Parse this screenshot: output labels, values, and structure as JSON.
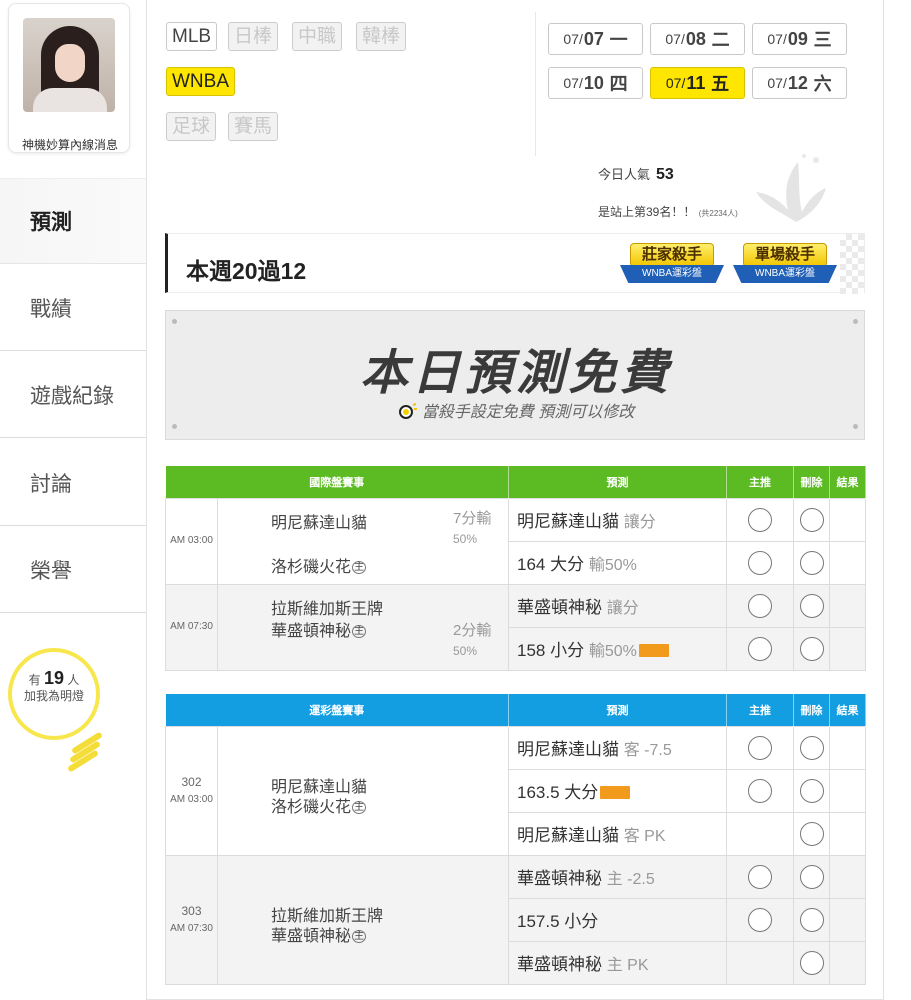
{
  "profile": {
    "name": "神機妙算內線消息"
  },
  "nav": [
    {
      "label": "預測",
      "active": true
    },
    {
      "label": "戰績"
    },
    {
      "label": "遊戲紀錄"
    },
    {
      "label": "討論"
    },
    {
      "label": "榮譽"
    }
  ],
  "lamp": {
    "prefix": "有",
    "count": "19",
    "suffix": "人",
    "line2": "加我為明燈"
  },
  "leagues": [
    "MLB",
    "日棒",
    "中職",
    "韓棒",
    "WNBA",
    "足球",
    "賽馬"
  ],
  "dates": [
    {
      "md": "07/",
      "day": "07",
      "dow": "一"
    },
    {
      "md": "07/",
      "day": "08",
      "dow": "二"
    },
    {
      "md": "07/",
      "day": "09",
      "dow": "三"
    },
    {
      "md": "07/",
      "day": "10",
      "dow": "四"
    },
    {
      "md": "07/",
      "day": "11",
      "dow": "五",
      "selected": true
    },
    {
      "md": "07/",
      "day": "12",
      "dow": "六"
    }
  ],
  "popularity": {
    "label": "今日人氣",
    "value": "53",
    "rank": "是站上第39名！！",
    "total": "(共2234人)"
  },
  "week": {
    "title": "本週20過12"
  },
  "badges": [
    {
      "title": "莊家殺手",
      "ribbon": "WNBA運彩盤"
    },
    {
      "title": "單場殺手",
      "ribbon": "WNBA運彩盤"
    }
  ],
  "banner": {
    "title": "本日預測免費",
    "subtitle": "當殺手設定免費 預測可以修改"
  },
  "intl_table": {
    "headers": [
      "國際盤賽事",
      "預測",
      "主推",
      "刪除",
      "結果"
    ],
    "games": [
      {
        "time": "AM 03:00",
        "away": "明尼蘇達山貓",
        "home": "洛杉磯火花",
        "home_tag": "主",
        "handicap": "7分輸",
        "handicap_pct": "50%",
        "picks": [
          {
            "main": "明尼蘇達山貓",
            "soft": "讓分"
          },
          {
            "main": "164 大分",
            "soft": "輸50%"
          }
        ]
      },
      {
        "time": "AM 07:30",
        "away": "拉斯維加斯王牌",
        "home": "華盛頓神秘",
        "home_tag": "主",
        "handicap": "2分輸",
        "handicap_pct": "50%",
        "picks": [
          {
            "main": "華盛頓神秘",
            "soft": "讓分"
          },
          {
            "main": "158 小分",
            "soft": "輸50%",
            "featured": true
          }
        ]
      }
    ]
  },
  "lottery_table": {
    "headers": [
      "運彩盤賽事",
      "預測",
      "主推",
      "刪除",
      "結果"
    ],
    "games": [
      {
        "number": "302",
        "time": "AM 03:00",
        "away": "明尼蘇達山貓",
        "home": "洛杉磯火花",
        "home_tag": "主",
        "picks": [
          {
            "main": "明尼蘇達山貓",
            "soft": "客 -7.5",
            "has_main": true
          },
          {
            "main": "163.5 大分",
            "soft": "",
            "featured": true,
            "has_main": true
          },
          {
            "main": "明尼蘇達山貓",
            "soft": "客 PK",
            "has_main": false
          }
        ]
      },
      {
        "number": "303",
        "time": "AM 07:30",
        "away": "拉斯維加斯王牌",
        "home": "華盛頓神秘",
        "home_tag": "主",
        "picks": [
          {
            "main": "華盛頓神秘",
            "soft": "主 -2.5",
            "has_main": true
          },
          {
            "main": "157.5 小分",
            "soft": "",
            "has_main": true
          },
          {
            "main": "華盛頓神秘",
            "soft": "主 PK",
            "has_main": false
          }
        ]
      }
    ]
  }
}
